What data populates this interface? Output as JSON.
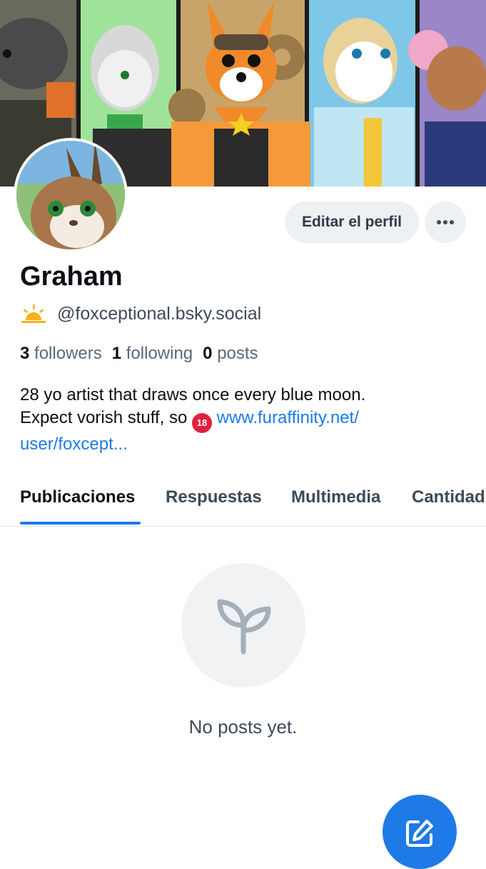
{
  "profile": {
    "display_name": "Graham",
    "handle": "@foxceptional.bsky.social",
    "followers_count": "3",
    "followers_label": "followers",
    "following_count": "1",
    "following_label": "following",
    "posts_count": "0",
    "posts_label": "posts",
    "bio_line1": "28 yo artist that draws once every blue moon.",
    "bio_line2_prefix": "Expect vorish stuff, so",
    "bio_badge": "18",
    "bio_link": "www.furaffinity.net/",
    "bio_link_cont": "user/foxcept..."
  },
  "actions": {
    "edit_profile": "Editar el perfil",
    "more_icon": "more-horizontal-icon"
  },
  "tabs": [
    {
      "label": "Publicaciones",
      "active": true
    },
    {
      "label": "Respuestas",
      "active": false
    },
    {
      "label": "Multimedia",
      "active": false
    },
    {
      "label": "Cantidad",
      "active": false
    }
  ],
  "empty_state": {
    "icon": "sprout-icon",
    "text": "No posts yet."
  },
  "fab": {
    "icon": "compose-icon"
  },
  "colors": {
    "accent": "#1d7ae6",
    "text_primary": "#0b0f14",
    "text_secondary": "#3d4a58",
    "button_bg": "#eef1f4"
  }
}
